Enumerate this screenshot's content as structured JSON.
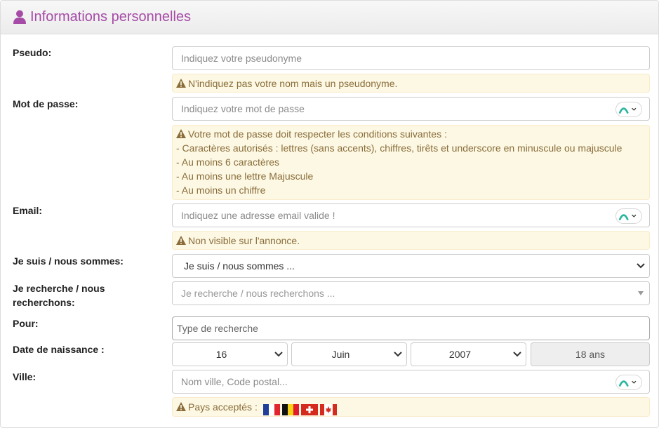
{
  "header": {
    "title": "Informations personnelles",
    "icon": "user-icon"
  },
  "fields": {
    "pseudo": {
      "label": "Pseudo:",
      "placeholder": "Indiquez votre pseudonyme",
      "hint": "N'indiquez pas votre nom mais un pseudonyme."
    },
    "password": {
      "label": "Mot de passe:",
      "placeholder": "Indiquez votre mot de passe",
      "rules_title": "Votre mot de passe doit respecter les conditions suivantes :",
      "rules": [
        "- Caractères autorisés : lettres (sans accents), chiffres, tirêts et underscore en minuscule ou majuscule",
        "- Au moins 6 caractères",
        "- Au moins une lettre Majuscule",
        "- Au moins un chiffre"
      ]
    },
    "email": {
      "label": "Email:",
      "placeholder": "Indiquez une adresse email valide !",
      "hint": "Non visible sur l'annonce."
    },
    "je_suis": {
      "label": "Je suis / nous sommes:",
      "selected": "Je suis / nous sommes ..."
    },
    "je_recherche": {
      "label": "Je recherche / nous recherchons:",
      "placeholder": "Je recherche / nous recherchons ..."
    },
    "pour": {
      "label": "Pour:",
      "placeholder": "Type de recherche"
    },
    "birthdate": {
      "label": "Date de naissance :",
      "day": "16",
      "month": "Juin",
      "year": "2007",
      "age": "18 ans"
    },
    "ville": {
      "label": "Ville:",
      "placeholder": "Nom ville, Code postal...",
      "hint": "Pays acceptés :",
      "flags": [
        "France",
        "Belgique",
        "Suisse",
        "Canada"
      ]
    }
  },
  "colors": {
    "title": "#a64ca6",
    "alert_bg": "#fcf8e3",
    "alert_text": "#8a6d3b",
    "badge_accent": "#2bb5a0"
  }
}
